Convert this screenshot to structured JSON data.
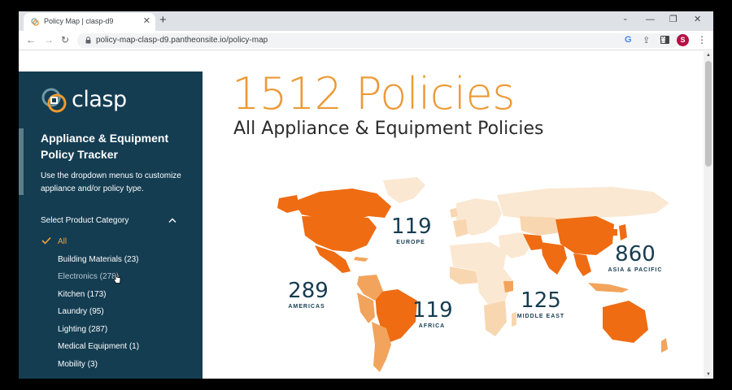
{
  "browser": {
    "tab_title": "Policy Map | clasp-d9",
    "tab_close": "✕",
    "new_tab": "+",
    "url": "policy-map-clasp-d9.pantheonsite.io/policy-map",
    "profile_initial": "S",
    "window_controls": {
      "minimize": "—",
      "restore": "❐",
      "close": "✕"
    }
  },
  "sidebar": {
    "logo_text": "clasp",
    "title": "Appliance & Equipment Policy Tracker",
    "description": "Use the dropdown menus to customize appliance and/or policy type.",
    "select_label": "Select Product Category",
    "categories": [
      {
        "label": "All"
      },
      {
        "label": "Building Materials (23)"
      },
      {
        "label": "Electronics (278)"
      },
      {
        "label": "Kitchen (173)"
      },
      {
        "label": "Laundry (95)"
      },
      {
        "label": "Lighting (287)"
      },
      {
        "label": "Medical Equipment (1)"
      },
      {
        "label": "Mobility (3)"
      }
    ]
  },
  "main": {
    "headline": "1512 Policies",
    "subtitle": "All Appliance & Equipment Policies"
  },
  "map": {
    "regions": {
      "americas": {
        "count": "289",
        "name": "AMERICAS"
      },
      "europe": {
        "count": "119",
        "name": "EUROPE"
      },
      "africa": {
        "count": "119",
        "name": "AFRICA"
      },
      "middle_east": {
        "count": "125",
        "name": "MIDDLE EAST"
      },
      "asia_pacific": {
        "count": "860",
        "name": "ASIA & PACIFIC"
      }
    },
    "colors": {
      "high": "#ef6c12",
      "mid": "#f2a45c",
      "low": "#f8d6b0",
      "lowest": "#fbe8d2",
      "label": "#163c50",
      "headline": "#ec9a35",
      "sidebar": "#143d52"
    }
  }
}
